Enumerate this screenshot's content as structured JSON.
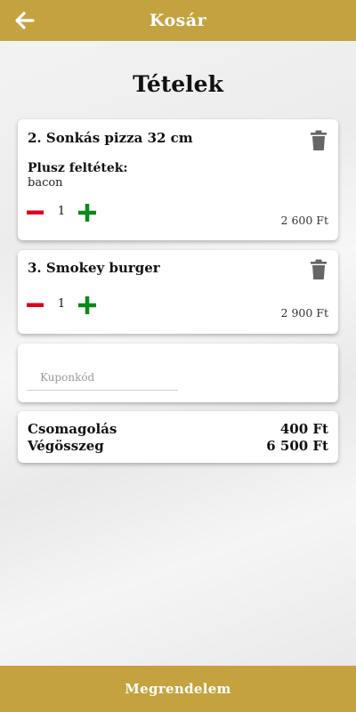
{
  "header": {
    "title": "Kosár",
    "back_icon": "arrow-left-icon"
  },
  "page_title": "Tételek",
  "items": [
    {
      "name": "2. Sonkás pizza 32 cm",
      "extras_label": "Plusz feltétek:",
      "extras_value": "bacon",
      "quantity": "1",
      "price": "2 600 Ft"
    },
    {
      "name": "3. Smokey burger",
      "quantity": "1",
      "price": "2 900 Ft"
    }
  ],
  "coupon": {
    "placeholder": "Kuponkód",
    "value": ""
  },
  "summary": {
    "packaging_label": "Csomagolás",
    "packaging_value": "400 Ft",
    "total_label": "Végösszeg",
    "total_value": "6 500 Ft"
  },
  "footer": {
    "order_label": "Megrendelem"
  },
  "colors": {
    "accent": "#c4a23f",
    "minus": "#e0001a",
    "plus": "#0a8a1a",
    "trash": "#666666"
  }
}
